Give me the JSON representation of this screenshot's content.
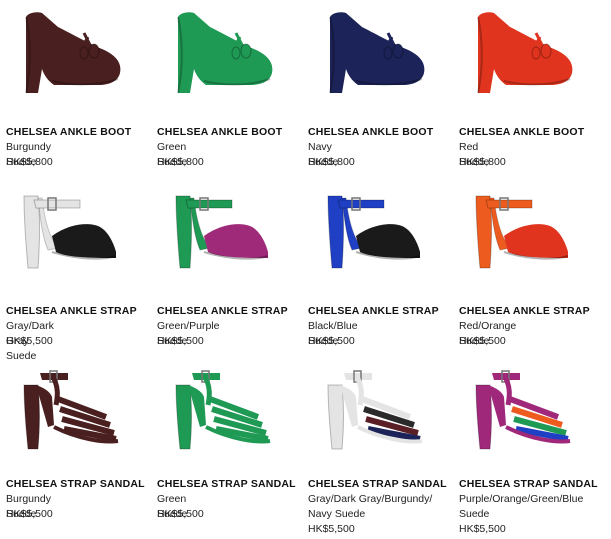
{
  "products": [
    {
      "name": "CHELSEA ANKLE BOOT",
      "color": "Burgundy Suede",
      "price": "HK$5,800",
      "style": "boot",
      "colors": [
        "#4a1f1f",
        "#4a1f1f"
      ]
    },
    {
      "name": "CHELSEA ANKLE BOOT",
      "color": "Green Suede",
      "price": "HK$5,800",
      "style": "boot",
      "colors": [
        "#1f9a55",
        "#1f9a55"
      ]
    },
    {
      "name": "CHELSEA ANKLE BOOT",
      "color": "Navy Suede",
      "price": "HK$5,800",
      "style": "boot",
      "colors": [
        "#1c2358",
        "#1c2358"
      ]
    },
    {
      "name": "CHELSEA ANKLE BOOT",
      "color": "Red Suede",
      "price": "HK$5,800",
      "style": "boot",
      "colors": [
        "#e0341e",
        "#e0341e"
      ]
    },
    {
      "name": "CHELSEA ANKLE STRAP",
      "color": "Gray/Dark Gray Suede",
      "price": "HK$5,500",
      "style": "strap",
      "colors": [
        "#e4e4e4",
        "#1a1a1a"
      ]
    },
    {
      "name": "CHELSEA ANKLE STRAP",
      "color": "Green/Purple Suede",
      "price": "HK$5,500",
      "style": "strap",
      "colors": [
        "#1f9a55",
        "#a02a7a"
      ]
    },
    {
      "name": "CHELSEA ANKLE STRAP",
      "color": "Black/Blue Suede",
      "price": "HK$5,500",
      "style": "strap",
      "colors": [
        "#1f3fc4",
        "#1a1a1a"
      ]
    },
    {
      "name": "CHELSEA ANKLE STRAP",
      "color": "Red/Orange Suede",
      "price": "HK$5,500",
      "style": "strap",
      "colors": [
        "#ee5b1e",
        "#e0341e"
      ]
    },
    {
      "name": "CHELSEA STRAP SANDAL",
      "color": "Burgundy Suede",
      "price": "HK$5,500",
      "style": "sandal",
      "colors": [
        "#4a1f1f",
        "#4a1f1f",
        "#4a1f1f",
        "#4a1f1f"
      ]
    },
    {
      "name": "CHELSEA STRAP SANDAL",
      "color": "Green Suede",
      "price": "HK$5,500",
      "style": "sandal",
      "colors": [
        "#1f9a55",
        "#1f9a55",
        "#1f9a55",
        "#1f9a55"
      ]
    },
    {
      "name": "CHELSEA STRAP SANDAL",
      "color": "Gray/Dark Gray/Burgundy/ Navy Suede",
      "price": "HK$5,500",
      "style": "sandal",
      "colors": [
        "#e4e4e4",
        "#2a2a2a",
        "#5a1f24",
        "#1c2358"
      ]
    },
    {
      "name": "CHELSEA STRAP SANDAL",
      "color": "Purple/Orange/Green/Blue Suede",
      "price": "HK$5,500",
      "style": "sandal",
      "colors": [
        "#a0287a",
        "#ee5b1e",
        "#1f9a55",
        "#1f3fc4"
      ]
    }
  ]
}
